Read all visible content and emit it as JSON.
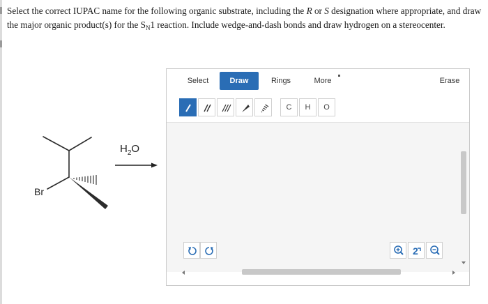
{
  "question": {
    "part1": "Select the correct IUPAC name for the following organic substrate, including the ",
    "r": "R",
    "or": " or ",
    "s": "S",
    "part2": " designation where appropriate, and draw the major organic product(s) for the S",
    "sub_n": "N",
    "part3": "1 reaction. Include wedge-and-dash bonds and draw hydrogen on a stereocenter."
  },
  "molecule": {
    "atom_label": "Br",
    "reagent_main": "H",
    "reagent_sub": "2",
    "reagent_tail": "O"
  },
  "widget": {
    "tabs": {
      "select": "Select",
      "draw": "Draw",
      "rings": "Rings",
      "more": "More",
      "erase": "Erase"
    },
    "atoms": [
      "C",
      "H",
      "O"
    ],
    "active_tab": "Draw",
    "active_tool": "single-bond",
    "accent_color": "#2a6db5"
  }
}
